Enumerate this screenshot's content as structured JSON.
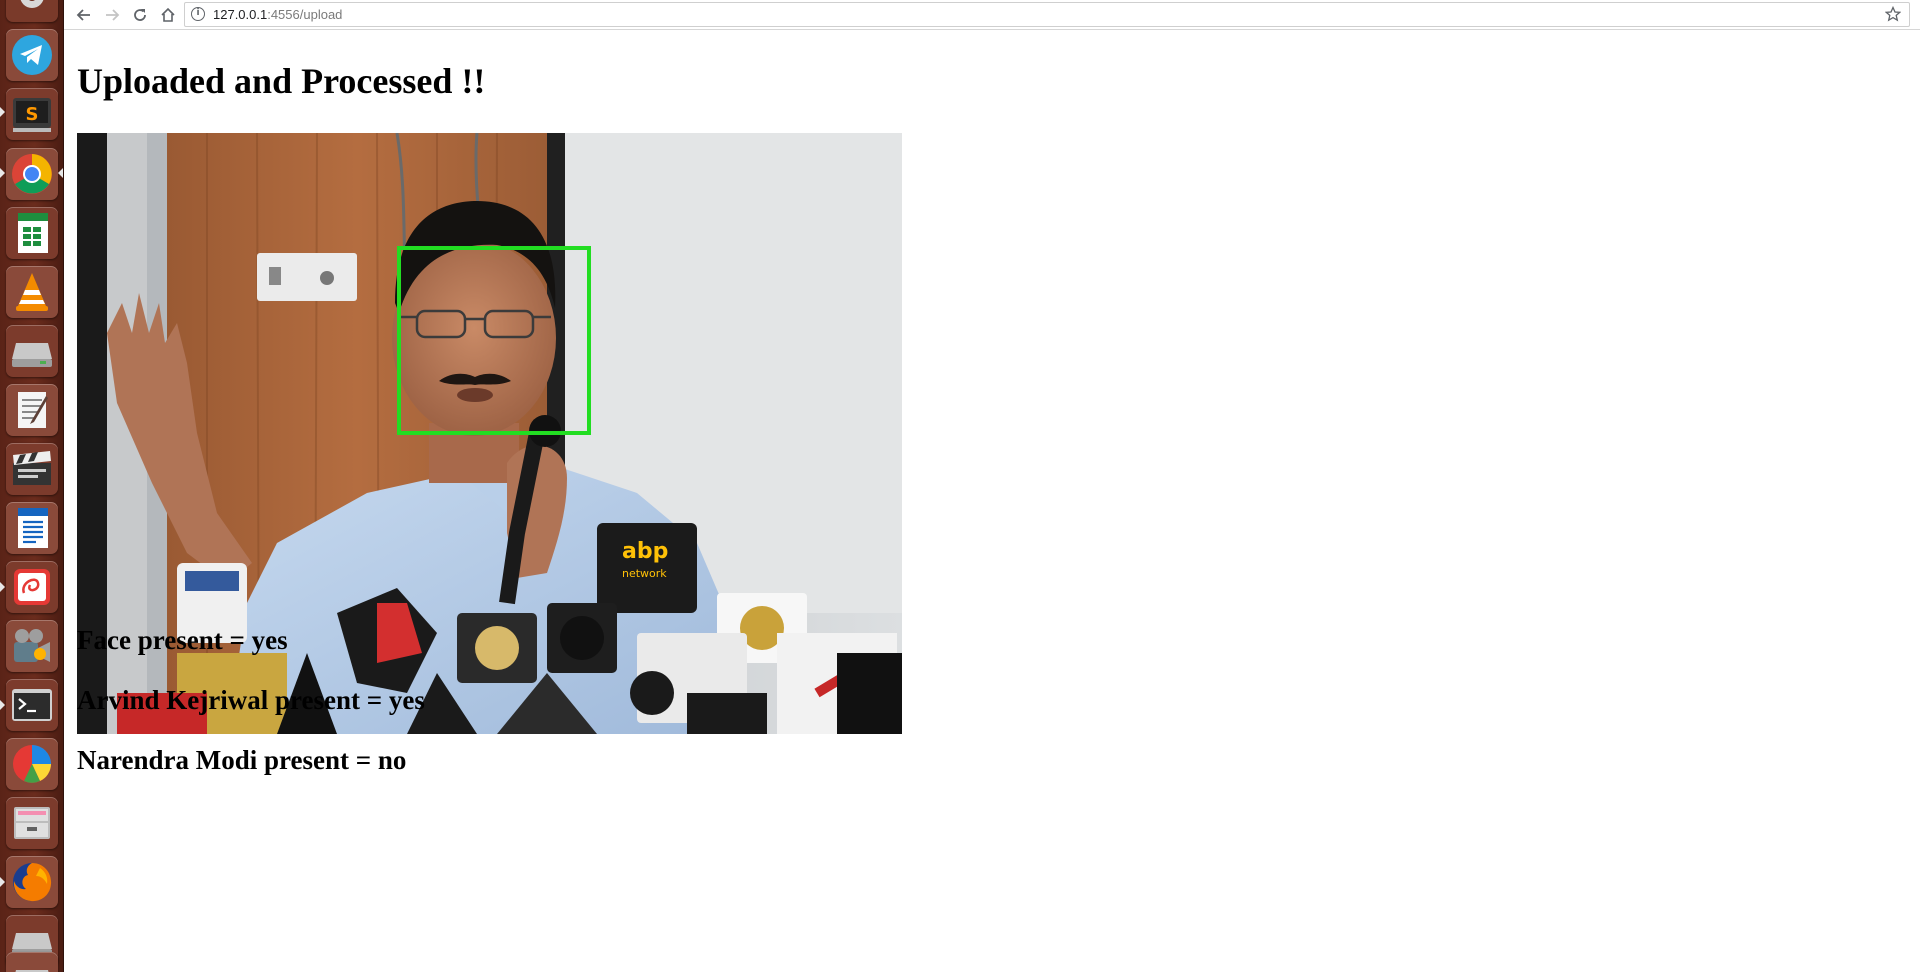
{
  "browser": {
    "url_host": "127.0.0.1",
    "url_rest": ":4556/upload"
  },
  "page": {
    "title": "Uploaded and Processed !!",
    "results": [
      "Face present = yes",
      "Arvind Kejriwal present = yes",
      "Narendra Modi present = no"
    ]
  },
  "image": {
    "box_color": "#22dd22",
    "mic_labels": [
      "abp",
      "network"
    ]
  },
  "colors": {
    "launcher_bg": "#5a2317",
    "face_box": "#22dd22"
  },
  "launcher": {
    "items": [
      {
        "name": "system-settings-icon"
      },
      {
        "name": "telegram-icon"
      },
      {
        "name": "sublime-text-icon"
      },
      {
        "name": "chrome-icon"
      },
      {
        "name": "libreoffice-calc-icon"
      },
      {
        "name": "vlc-icon"
      },
      {
        "name": "disk-drive-icon"
      },
      {
        "name": "text-editor-icon"
      },
      {
        "name": "video-editor-icon"
      },
      {
        "name": "libreoffice-writer-icon"
      },
      {
        "name": "evince-icon"
      },
      {
        "name": "media-converter-icon"
      },
      {
        "name": "terminal-icon"
      },
      {
        "name": "disk-usage-icon"
      },
      {
        "name": "archive-manager-icon"
      },
      {
        "name": "firefox-icon"
      },
      {
        "name": "removable-drive-icon"
      },
      {
        "name": "removable-drive-2-icon"
      }
    ]
  }
}
